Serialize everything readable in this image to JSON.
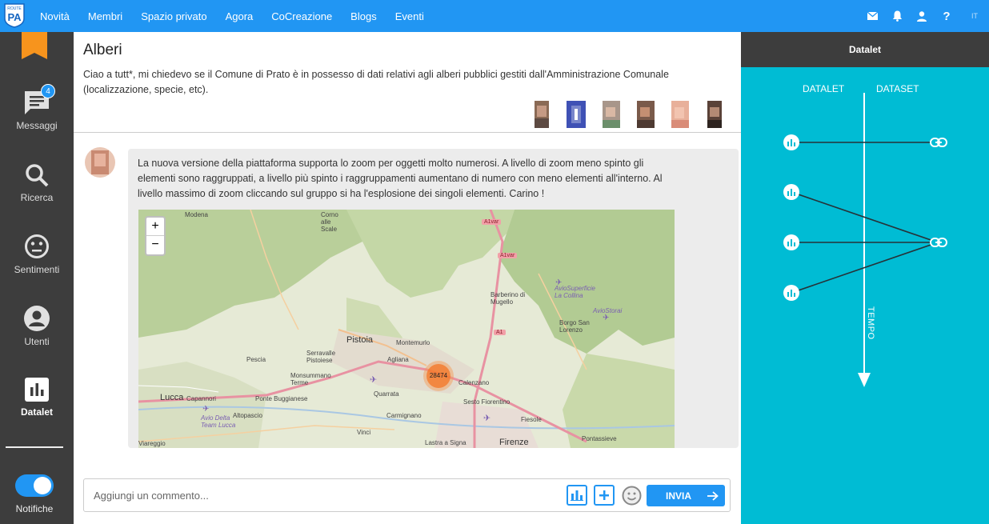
{
  "topbar": {
    "logo_text": "PA",
    "logo_sub": "ROUTE",
    "nav": [
      "Novità",
      "Membri",
      "Spazio privato",
      "Agora",
      "CoCreazione",
      "Blogs",
      "Eventi"
    ],
    "icons": [
      "mail-icon",
      "bell-icon",
      "user-icon",
      "help-icon"
    ],
    "lang": "IT",
    "accent": "#2196f3"
  },
  "sidebar": {
    "messages": {
      "label": "Messaggi",
      "badge": "4"
    },
    "search": {
      "label": "Ricerca"
    },
    "sentiment": {
      "label": "Sentimenti"
    },
    "users": {
      "label": "Utenti"
    },
    "datalet": {
      "label": "Datalet"
    },
    "notifications": {
      "label": "Notifiche",
      "enabled": true
    },
    "bg": "#3d3d3d",
    "bookmark_color": "#f7941d"
  },
  "post": {
    "title": "Alberi",
    "body": "Ciao a tutt*, mi chiedevo se il Comune di Prato è in possesso di dati relativi agli alberi pubblici gestiti dall'Amministrazione Comunale (localizzazione, specie, etc)."
  },
  "comment": {
    "text": "La nuova versione della piattaforma supporta lo zoom per oggetti molto numerosi. A livello di zoom meno spinto gli elementi sono raggruppati, a livello più spinto i raggruppamenti aumentano di numero con meno elementi all'interno. Al livello massimo di zoom cliccando sul gruppo si ha l'esplosione dei singoli elementi. Carino !",
    "map": {
      "zoom_in": "+",
      "zoom_out": "−",
      "cluster_count": "28474",
      "places": [
        "Modena",
        "Corno alle Scale",
        "A1var",
        "A1var",
        "Barberino di Mugello",
        "AvioSuperficie La Collina",
        "AvioStorai",
        "Borgo San Lorenzo",
        "A1",
        "Pistoia",
        "Montemurlo",
        "Serravalle Pistoiese",
        "Pescia",
        "Agliana",
        "Monsummano Terme",
        "Calenzano",
        "Lucca",
        "Capannori",
        "Ponte Buggianese",
        "Quarrata",
        "Sesto Fiorentino",
        "Altopascio",
        "Avio Delta Team Lucca",
        "Carmignano",
        "Fiesole",
        "Vinci",
        "Lastra a Signa",
        "Firenze",
        "Pontassieve",
        "Viareggio"
      ]
    }
  },
  "composer": {
    "placeholder": "Aggiungi un commento...",
    "send_label": "INVIA"
  },
  "datalet_panel": {
    "title": "Datalet",
    "col_datalet": "DATALET",
    "col_dataset": "DATASET",
    "axis_label": "TEMPO",
    "bg": "#00bcd4"
  }
}
